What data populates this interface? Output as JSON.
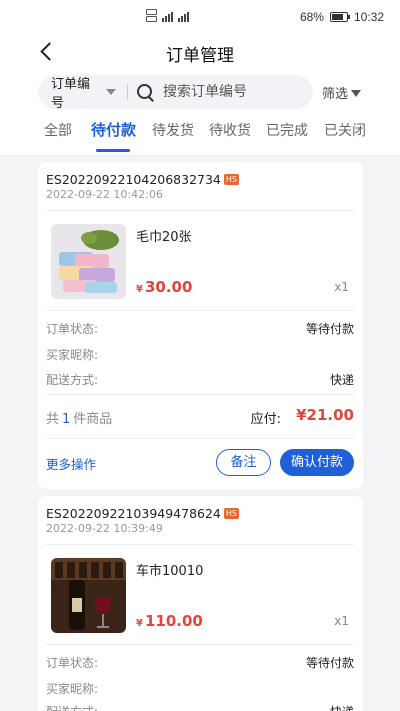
{
  "status_bar": {
    "battery": "68%",
    "battery_level": 0.68,
    "time": "10:32",
    "signal_text": "46"
  },
  "nav": {
    "title": "订单管理"
  },
  "search": {
    "type_label": "订单编号",
    "placeholder": "搜索订单编号",
    "filter_label": "筛选"
  },
  "tabs": [
    {
      "label": "全部",
      "active": false
    },
    {
      "label": "待付款",
      "active": true
    },
    {
      "label": "待发货",
      "active": false
    },
    {
      "label": "待收货",
      "active": false
    },
    {
      "label": "已完成",
      "active": false
    },
    {
      "label": "已关闭",
      "active": false
    }
  ],
  "orders": [
    {
      "order_no": "ES20220922104206832734",
      "badge": "HS",
      "time": "2022-09-22 10:42:06",
      "product_name": "毛巾20张",
      "currency": "¥",
      "price": "30.00",
      "quantity": "x1",
      "status_label": "订单状态:",
      "status_value": "等待付款",
      "buyer_label": "买家昵称:",
      "buyer_value": "",
      "delivery_label": "配送方式:",
      "delivery_value": "快递",
      "count_prefix": "共",
      "count": "1",
      "count_suffix": "件商品",
      "total_label": "应付:",
      "total_amount": "¥21.00",
      "more_ops": "更多操作",
      "remark_btn": "备注",
      "confirm_btn": "确认付款"
    },
    {
      "order_no": "ES20220922103949478624",
      "badge": "HS",
      "time": "2022-09-22 10:39:49",
      "product_name": "车市10010",
      "currency": "¥",
      "price": "110.00",
      "quantity": "x1",
      "status_label": "订单状态:",
      "status_value": "等待付款",
      "buyer_label": "买家昵称:",
      "buyer_value": "",
      "delivery_label": "配送方式:",
      "delivery_value": "快递"
    }
  ],
  "icons": {
    "back": "back-arrow-icon",
    "search": "search-icon",
    "filter": "filter-funnel-icon",
    "caret": "caret-down-icon"
  },
  "colors": {
    "accent": "#1f5fd8",
    "price": "#e0473c",
    "badge": "#e9662c"
  }
}
